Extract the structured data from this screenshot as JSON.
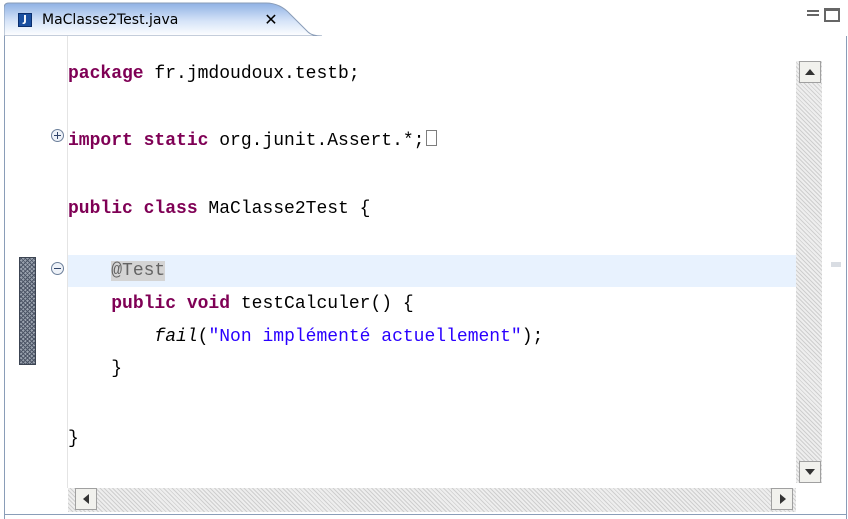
{
  "tab": {
    "title": "MaClasse2Test.java",
    "icon": "java-file-icon",
    "icon_glyph": "J",
    "close_glyph": "✕"
  },
  "code": {
    "l1": {
      "kw": "package",
      "rest": " fr.jmdoudoux.testb;"
    },
    "l2": {
      "kw1": "import",
      "kw2": " static",
      "rest": " org.junit.Assert.*;"
    },
    "l3": {
      "kw1": "public",
      "kw2": " class",
      "rest": " MaClasse2Test {"
    },
    "l4": {
      "indent": "    ",
      "annotation": "@Test"
    },
    "l5": {
      "indent": "    ",
      "kw1": "public",
      "kw2": " void",
      "rest": " testCalculer() {"
    },
    "l6": {
      "indent": "        ",
      "method": "fail",
      "open": "(",
      "string": "\"Non implémenté actuellement\"",
      "close": ");"
    },
    "l7": {
      "text": "    }"
    },
    "l8": {
      "text": "}"
    }
  },
  "colors": {
    "keyword": "#7f0055",
    "string": "#2a00ff",
    "annotation": "#646464",
    "current_line": "#e8f2fe",
    "tab_gradient_top": "#8fb1e4",
    "border": "#8a9db8"
  }
}
